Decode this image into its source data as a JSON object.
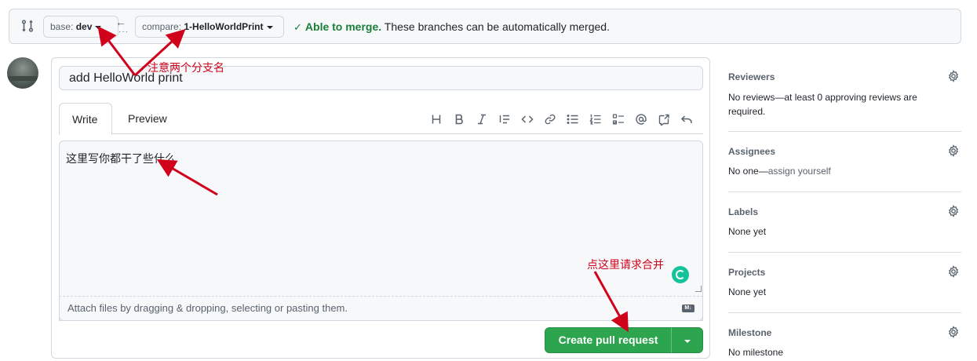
{
  "compare_bar": {
    "base_prefix": "base:",
    "base_branch": "dev",
    "compare_prefix": "compare:",
    "compare_branch": "1-HelloWorldPrint",
    "merge_ok": "Able to merge.",
    "merge_text": "These branches can be automatically merged."
  },
  "form": {
    "title_value": "add HelloWorld print",
    "tabs": [
      "Write",
      "Preview"
    ],
    "body_value": "这里写你都干了些什么",
    "attach_hint": "Attach files by dragging & dropping, selecting or pasting them.",
    "toolbar_icons": [
      "heading-icon",
      "bold-icon",
      "italic-icon",
      "quote-icon",
      "code-icon",
      "link-icon",
      "unordered-list-icon",
      "ordered-list-icon",
      "task-list-icon",
      "mention-icon",
      "cross-reference-icon",
      "undo-icon"
    ],
    "submit_label": "Create pull request"
  },
  "sidebar": {
    "reviewers": {
      "title": "Reviewers",
      "text": "No reviews—at least 0 approving reviews are required."
    },
    "assignees": {
      "title": "Assignees",
      "text_prefix": "No one—",
      "link": "assign yourself"
    },
    "labels": {
      "title": "Labels",
      "text": "None yet"
    },
    "projects": {
      "title": "Projects",
      "text": "None yet"
    },
    "milestone": {
      "title": "Milestone",
      "text": "No milestone"
    }
  },
  "annotations": {
    "branches_note": "注意两个分支名",
    "submit_note": "点这里请求合并"
  },
  "colors": {
    "accent_green": "#2da44e",
    "merge_green": "#1a7f37",
    "annotation_red": "#d0021b"
  }
}
